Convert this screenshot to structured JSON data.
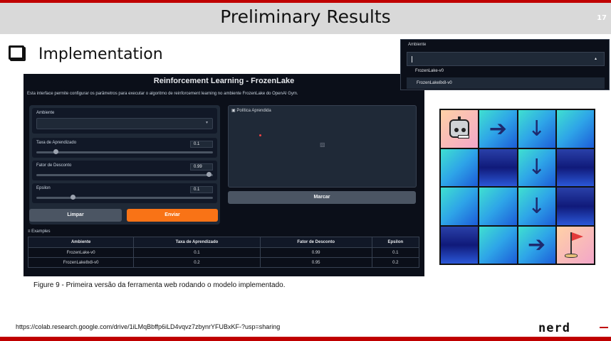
{
  "slide": {
    "title": "Preliminary Results",
    "page_number": "17",
    "heading": "Implementation",
    "caption": "Figure 9 - Primeira versão da ferramenta web rodando o modelo implementado.",
    "link": "https://colab.research.google.com/drive/1iLMqBbffp6iLD4vqvz7zbynrYFUBxKF-?usp=sharing",
    "logo_text": "nerd"
  },
  "app": {
    "title": "Reinforcement Learning - FrozenLake",
    "description": "Esta interface permite configurar os parâmetros para executar o algoritmo de reinforcement learning no ambiente FrozenLake do OpenAI Gym.",
    "ambiente_label": "Ambiente",
    "ambiente_value": "",
    "learning_rate_label": "Taxa de Aprendizado",
    "learning_rate_value": "0.1",
    "learning_rate_level": 0.1,
    "discount_label": "Fator de Desconto",
    "discount_value": "0.99",
    "discount_level": 0.99,
    "epsilon_label": "Epsilon",
    "epsilon_value": "0.1",
    "epsilon_level": 0.2,
    "clear_button": "Limpar",
    "submit_button": "Enviar",
    "policy_label": "Política Aprendida",
    "mark_button": "Marcar",
    "examples_label": "Examples",
    "examples": {
      "headers": [
        "Ambiente",
        "Taxa de Aprendizado",
        "Fator de Desconto",
        "Epsilon"
      ],
      "rows": [
        [
          "FrozenLake-v0",
          "0.1",
          "0.99",
          "0.1"
        ],
        [
          "FrozenLake8x8-v0",
          "0.2",
          "0.95",
          "0.2"
        ]
      ]
    }
  },
  "dropdown": {
    "label": "Ambiente",
    "options": [
      "FrozenLake-v0",
      "FrozenLake8x8-v0"
    ]
  },
  "grid": {
    "rows": [
      [
        "robot",
        "right",
        "down",
        ""
      ],
      [
        "",
        "",
        "down",
        ""
      ],
      [
        "",
        "",
        "down",
        ""
      ],
      [
        "",
        "",
        "right",
        "goal"
      ]
    ],
    "arrows": {
      "right": "➔",
      "down": "↓"
    }
  }
}
